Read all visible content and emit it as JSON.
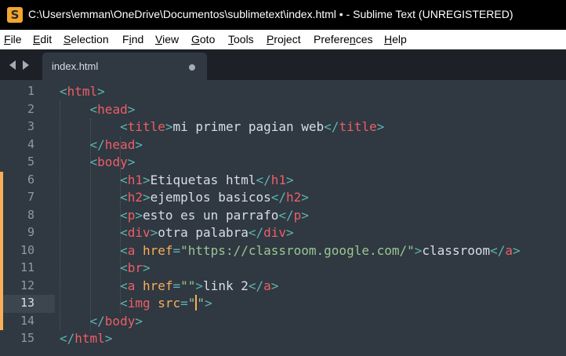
{
  "window": {
    "title": "C:\\Users\\emman\\OneDrive\\Documentos\\sublimetext\\index.html • - Sublime Text (UNREGISTERED)",
    "app_icon": "S"
  },
  "menu": [
    {
      "u": "F",
      "rest": "ile"
    },
    {
      "u": "E",
      "rest": "dit"
    },
    {
      "u": "S",
      "rest": "election"
    },
    {
      "pre": "F",
      "u": "i",
      "rest": "nd"
    },
    {
      "u": "V",
      "rest": "iew"
    },
    {
      "u": "G",
      "rest": "oto"
    },
    {
      "u": "T",
      "rest": "ools"
    },
    {
      "u": "P",
      "rest": "roject"
    },
    {
      "pre": "Prefere",
      "u": "n",
      "rest": "ces"
    },
    {
      "u": "H",
      "rest": "elp"
    }
  ],
  "tab": {
    "label": "index.html",
    "dirty": true
  },
  "editor": {
    "current_line": 13,
    "modified_lines": [
      6,
      7,
      8,
      9,
      10,
      11,
      12,
      13,
      14
    ],
    "line_numbers": [
      "1",
      "2",
      "3",
      "4",
      "5",
      "6",
      "7",
      "8",
      "9",
      "10",
      "11",
      "12",
      "13",
      "14",
      "15"
    ],
    "lines": [
      [
        [
          "punct",
          "<"
        ],
        [
          "tag",
          "html"
        ],
        [
          "punct",
          ">"
        ]
      ],
      [
        [
          "txt",
          "    "
        ],
        [
          "punct",
          "<"
        ],
        [
          "tag",
          "head"
        ],
        [
          "punct",
          ">"
        ]
      ],
      [
        [
          "txt",
          "        "
        ],
        [
          "punct",
          "<"
        ],
        [
          "tag",
          "title"
        ],
        [
          "punct",
          ">"
        ],
        [
          "txt",
          "mi primer pagian web"
        ],
        [
          "punct",
          "</"
        ],
        [
          "tag",
          "title"
        ],
        [
          "punct",
          ">"
        ]
      ],
      [
        [
          "txt",
          "    "
        ],
        [
          "punct",
          "</"
        ],
        [
          "tag",
          "head"
        ],
        [
          "punct",
          ">"
        ]
      ],
      [
        [
          "txt",
          "    "
        ],
        [
          "punct",
          "<"
        ],
        [
          "tag",
          "body"
        ],
        [
          "punct",
          ">"
        ]
      ],
      [
        [
          "txt",
          "        "
        ],
        [
          "punct",
          "<"
        ],
        [
          "tag",
          "h1"
        ],
        [
          "punct",
          ">"
        ],
        [
          "txt",
          "Etiquetas html"
        ],
        [
          "punct",
          "</"
        ],
        [
          "tag",
          "h1"
        ],
        [
          "punct",
          ">"
        ]
      ],
      [
        [
          "txt",
          "        "
        ],
        [
          "punct",
          "<"
        ],
        [
          "tag",
          "h2"
        ],
        [
          "punct",
          ">"
        ],
        [
          "txt",
          "ejemplos basicos"
        ],
        [
          "punct",
          "</"
        ],
        [
          "tag",
          "h2"
        ],
        [
          "punct",
          ">"
        ]
      ],
      [
        [
          "txt",
          "        "
        ],
        [
          "punct",
          "<"
        ],
        [
          "tag",
          "p"
        ],
        [
          "punct",
          ">"
        ],
        [
          "txt",
          "esto es un parrafo"
        ],
        [
          "punct",
          "</"
        ],
        [
          "tag",
          "p"
        ],
        [
          "punct",
          ">"
        ]
      ],
      [
        [
          "txt",
          "        "
        ],
        [
          "punct",
          "<"
        ],
        [
          "tag",
          "div"
        ],
        [
          "punct",
          ">"
        ],
        [
          "txt",
          "otra palabra"
        ],
        [
          "punct",
          "</"
        ],
        [
          "tag",
          "div"
        ],
        [
          "punct",
          ">"
        ]
      ],
      [
        [
          "txt",
          "        "
        ],
        [
          "punct",
          "<"
        ],
        [
          "tag",
          "a "
        ],
        [
          "attr",
          "href"
        ],
        [
          "punct",
          "="
        ],
        [
          "str",
          "\"https://classroom.google.com/\""
        ],
        [
          "punct",
          ">"
        ],
        [
          "txt",
          "classroom"
        ],
        [
          "punct",
          "</"
        ],
        [
          "tag",
          "a"
        ],
        [
          "punct",
          ">"
        ]
      ],
      [
        [
          "txt",
          "        "
        ],
        [
          "punct",
          "<"
        ],
        [
          "tag",
          "br"
        ],
        [
          "punct",
          ">"
        ]
      ],
      [
        [
          "txt",
          "        "
        ],
        [
          "punct",
          "<"
        ],
        [
          "tag",
          "a "
        ],
        [
          "attr",
          "href"
        ],
        [
          "punct",
          "="
        ],
        [
          "str",
          "\"\""
        ],
        [
          "punct",
          ">"
        ],
        [
          "txt",
          "link 2"
        ],
        [
          "punct",
          "</"
        ],
        [
          "tag",
          "a"
        ],
        [
          "punct",
          ">"
        ]
      ],
      [
        [
          "txt",
          "        "
        ],
        [
          "punct",
          "<"
        ],
        [
          "tag",
          "img "
        ],
        [
          "attr",
          "src"
        ],
        [
          "punct",
          "="
        ],
        [
          "str",
          "\""
        ],
        [
          "cursor",
          ""
        ],
        [
          "str",
          "\""
        ],
        [
          "punct",
          ">"
        ]
      ],
      [
        [
          "txt",
          "    "
        ],
        [
          "punct",
          "</"
        ],
        [
          "tag",
          "body"
        ],
        [
          "punct",
          ">"
        ]
      ],
      [
        [
          "punct",
          "</"
        ],
        [
          "tag",
          "html"
        ],
        [
          "punct",
          ">"
        ]
      ]
    ]
  },
  "colors": {
    "background": "#303841",
    "tag": "#ec5f67",
    "punctuation": "#5fb3b3",
    "attribute": "#f9ae58",
    "string": "#99c794",
    "text": "#d8dee9",
    "modified_marker": "#f9ae58"
  }
}
